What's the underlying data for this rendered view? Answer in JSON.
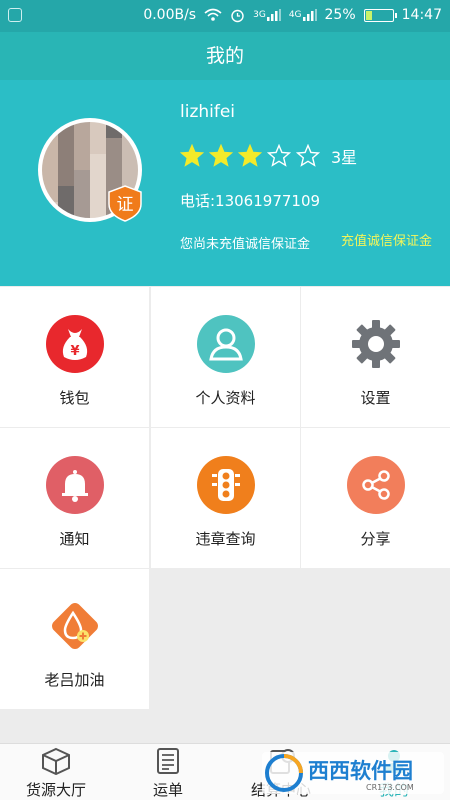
{
  "status_bar": {
    "speed": "0.00B/s",
    "network_a": "3G",
    "network_b": "4G",
    "battery": "25%",
    "battery_level": 0.25,
    "time": "14:47"
  },
  "title": "我的",
  "profile": {
    "username": "lizhifei",
    "badge": "证",
    "rating_stars": 3,
    "rating_max": 5,
    "rating_label": "3星",
    "phone": "电话:13061977109",
    "deposit_notice": "您尚未充值诚信保证金",
    "recharge_link": "充值诚信保证金"
  },
  "menu": {
    "wallet": {
      "label": "钱包",
      "icon": "money-bag-icon",
      "icon_glyph": "¥",
      "color": "#e8282d"
    },
    "profile": {
      "label": "个人资料",
      "icon": "person-icon",
      "color": "#4fc3c0"
    },
    "settings": {
      "label": "设置",
      "icon": "gear-icon",
      "color": "#6f7378"
    },
    "notify": {
      "label": "通知",
      "icon": "bell-icon",
      "color": "#e05f66"
    },
    "violation": {
      "label": "违章查询",
      "icon": "traffic-light-icon",
      "color": "#f07f1c"
    },
    "share": {
      "label": "分享",
      "icon": "share-icon",
      "color": "#f27e5b"
    },
    "fuel": {
      "label": "老吕加油",
      "icon": "fuel-drop-icon",
      "color": "#f07d37"
    }
  },
  "bottom_nav": {
    "cargo": {
      "label": "货源大厅",
      "icon": "cube-icon"
    },
    "waybill": {
      "label": "运单",
      "icon": "document-icon"
    },
    "settle": {
      "label": "结算中心",
      "icon": "settlement-icon"
    },
    "mine": {
      "label": "我的",
      "icon": "user-icon",
      "active": true,
      "color": "#2bb5b8"
    }
  },
  "watermark": {
    "text": "西西软件园",
    "sub": "CR173.COM"
  }
}
